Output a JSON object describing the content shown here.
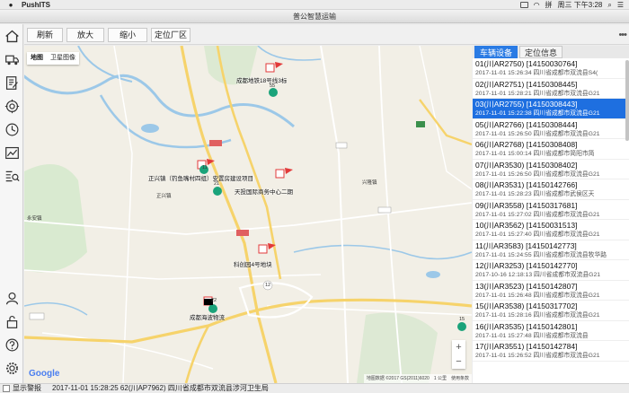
{
  "menubar": {
    "app_name": "PushITS",
    "clock": "周三 下午3:28"
  },
  "window": {
    "title": "普公智慧运输"
  },
  "toolbar": {
    "refresh": "刷新",
    "zoom_in": "放大",
    "zoom_out": "缩小",
    "locate_factory": "定位厂区"
  },
  "map": {
    "type_map": "地图",
    "type_satellite": "卫星图像",
    "google": "Google",
    "attribution": "地图数据 ©2017 GS(2011)6020　1 公里　使用条款",
    "zoom_in": "+",
    "zoom_out": "−",
    "places": [
      {
        "name": "成都地铁18号线3标"
      },
      {
        "name": "正兴镇（钓鱼嘴村四组）安置房建设项目"
      },
      {
        "name": "天投国际商务中心二期"
      },
      {
        "name": "科创园4号地块"
      },
      {
        "name": "成都海波物流"
      }
    ],
    "truck_counts": [
      "55",
      "21",
      "11",
      "12",
      "22",
      "15"
    ],
    "town_labels": [
      "正兴镇",
      "兴隆镇",
      "永安镇"
    ]
  },
  "panel": {
    "tab_vehicles": "车辆设备",
    "tab_location": "定位信息",
    "vehicles": [
      {
        "line1": "01(川AR2750) [14150030764]",
        "line2": "2017-11-01 15:26:34  四川省成都市双流县S4("
      },
      {
        "line1": "02(川AR2751) [14150308445]",
        "line2": "2017-11-01 15:28:21  四川省成都市双流县G21"
      },
      {
        "line1": "03(川AR2755) [14150308443]",
        "line2": "2017-11-01 15:22:38  四川省成都市双流县G21",
        "selected": true
      },
      {
        "line1": "05(川AR2766) [14150308444]",
        "line2": "2017-11-01 15:26:50  四川省成都市双流县G21"
      },
      {
        "line1": "06(川AR2768) [14150308408]",
        "line2": "2017-11-01 15:00:14  四川省成都市简阳市简"
      },
      {
        "line1": "07(川AR3530) [14150308402]",
        "line2": "2017-11-01 15:26:50  四川省成都市双流县G21"
      },
      {
        "line1": "08(川AR3531) [14150142766]",
        "line2": "2017-11-01 15:28:23  四川省成都市武侯区天"
      },
      {
        "line1": "09(川AR3558) [14150317681]",
        "line2": "2017-11-01 15:27:02  四川省成都市双流县G21"
      },
      {
        "line1": "10(川AR3562) [14150031513]",
        "line2": "2017-11-01 15:27:40  四川省成都市双流县G21"
      },
      {
        "line1": "11(川AR3583) [14150142773]",
        "line2": "2017-11-01 15:24:55  四川省成都市双流县牧华路"
      },
      {
        "line1": "12(川AR3253) [14150142770]",
        "line2": "2017-10-16 12:18:13  四川省成都市双流县G21"
      },
      {
        "line1": "13(川AR3523) [14150142807]",
        "line2": "2017-11-01 15:26:48  四川省成都市双流县G21"
      },
      {
        "line1": "15(川AR3538) [14150317702]",
        "line2": "2017-11-01 15:28:16  四川省成都市双流县G21"
      },
      {
        "line1": "16(川AR3535) [14150142801]",
        "line2": "2017-11-01 15:27:48  四川省成都市双流县"
      },
      {
        "line1": "17(川AR3551) [14150142784]",
        "line2": "2017-11-01 15:26:52  四川省成都市双流县G21"
      }
    ]
  },
  "statusbar": {
    "show_alarm": "显示警报",
    "message": "2017-11-01 15:28:25  62(川AP7962)  四川省成都市双流县涉河卫生局"
  },
  "colors": {
    "accent": "#1e6fe0",
    "river": "#9cc8e8",
    "road_major": "#f6d36b",
    "truck_marker": "#1aa37a",
    "flag": "#e23a3a"
  }
}
